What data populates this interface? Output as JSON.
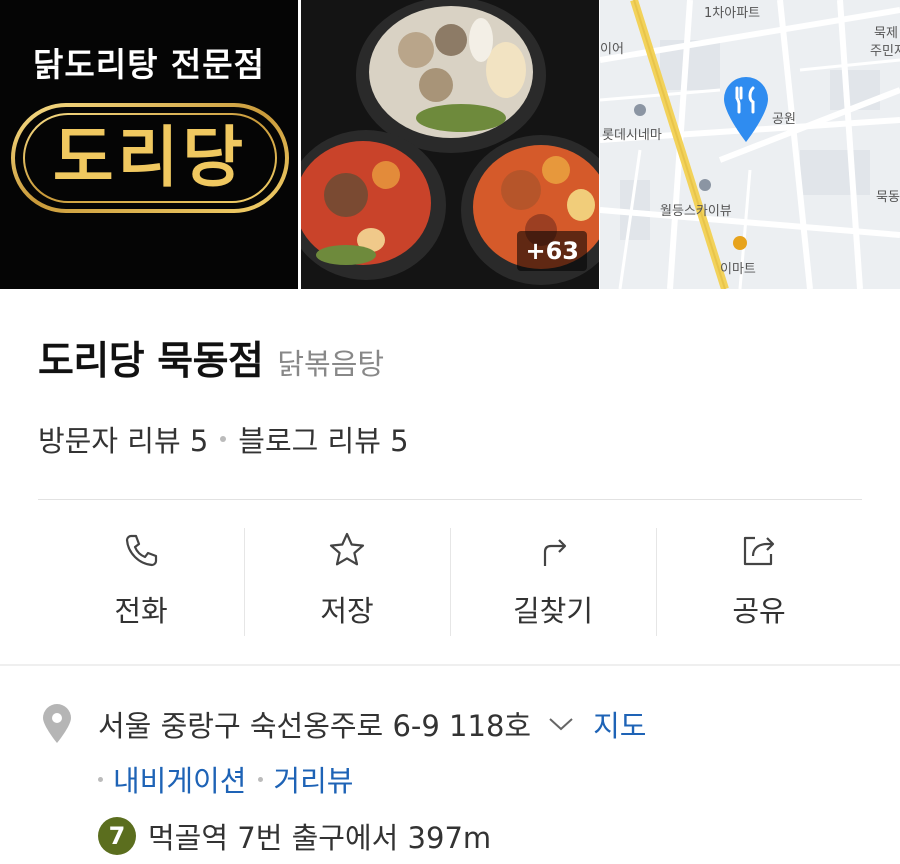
{
  "gallery": {
    "logo_top": "닭도리탕 전문점",
    "logo_name": "도리당",
    "more_photos": "+63",
    "map_labels": [
      "1차아파트",
      "이어",
      "묵제",
      "주민지",
      "롯데시네마",
      "공원",
      "월등스카이뷰",
      "이마트",
      "묵동"
    ]
  },
  "place": {
    "name": "도리당 묵동점",
    "category": "닭볶음탕"
  },
  "reviews": {
    "visitor": "방문자 리뷰 5",
    "blog": "블로그 리뷰 5"
  },
  "actions": [
    {
      "label": "전화",
      "icon": "phone-icon"
    },
    {
      "label": "저장",
      "icon": "star-icon"
    },
    {
      "label": "길찾기",
      "icon": "directions-icon"
    },
    {
      "label": "공유",
      "icon": "share-icon"
    }
  ],
  "address": {
    "text": "서울 중랑구 숙선옹주로 6-9 118호",
    "map_link": "지도",
    "navigation_link": "내비게이션",
    "streetview_link": "거리뷰"
  },
  "subway": {
    "line": "7",
    "line_color": "#5b6e1e",
    "text": "먹골역 7번 출구에서 397m"
  },
  "colors": {
    "link": "#1e63b6",
    "logo_gold": "#f0c860",
    "map_pin": "#2f8cf0"
  }
}
